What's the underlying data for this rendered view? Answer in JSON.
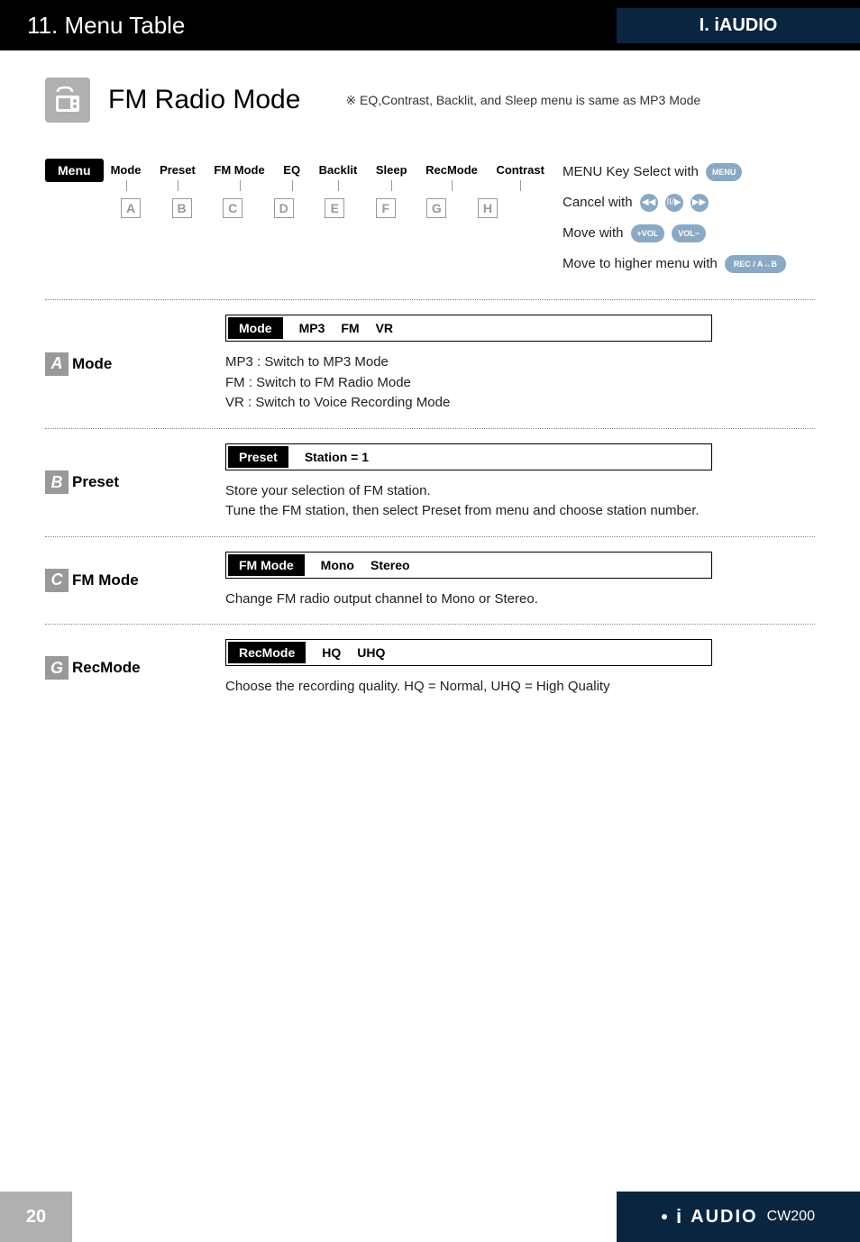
{
  "header": {
    "chapter": "11. Menu Table",
    "section": "I. iAUDIO"
  },
  "page": {
    "heading": "FM Radio Mode",
    "note": "※ EQ,Contrast, Backlit, and Sleep menu is same as MP3 Mode"
  },
  "menuBar": {
    "label": "Menu",
    "items": [
      "Mode",
      "Preset",
      "FM Mode",
      "EQ",
      "Backlit",
      "Sleep",
      "RecMode",
      "Contrast"
    ],
    "letters": [
      "A",
      "B",
      "C",
      "D",
      "E",
      "F",
      "G",
      "H"
    ]
  },
  "legend": {
    "select": "MENU Key Select with",
    "selectBtn": "MENU",
    "cancel": "Cancel with",
    "cancelBtns": [
      "◀◀",
      "II/▶",
      "▶▶"
    ],
    "move": "Move with",
    "moveBtns": [
      "+VOL",
      "VOL−"
    ],
    "higher": "Move to higher menu with",
    "higherBtn": "REC / A↔B"
  },
  "sections": [
    {
      "letter": "A",
      "label": "Mode",
      "pill": "Mode",
      "options": [
        "MP3",
        "FM",
        "VR"
      ],
      "desc": "MP3 : Switch to MP3 Mode\nFM : Switch to FM Radio Mode\nVR : Switch to Voice Recording Mode"
    },
    {
      "letter": "B",
      "label": "Preset",
      "pill": "Preset",
      "options": [
        "Station = 1"
      ],
      "desc": "Store your selection of FM station.\nTune the FM station, then select Preset from menu and choose station number."
    },
    {
      "letter": "C",
      "label": "FM Mode",
      "pill": "FM Mode",
      "options": [
        "Mono",
        "Stereo"
      ],
      "desc": "Change FM radio output channel to Mono or Stereo."
    },
    {
      "letter": "G",
      "label": "RecMode",
      "pill": "RecMode",
      "options": [
        "HQ",
        "UHQ"
      ],
      "desc": "Choose the recording quality. HQ = Normal, UHQ = High Quality"
    }
  ],
  "footer": {
    "pageNum": "20",
    "brand": "AUDIO",
    "model": "CW200"
  }
}
